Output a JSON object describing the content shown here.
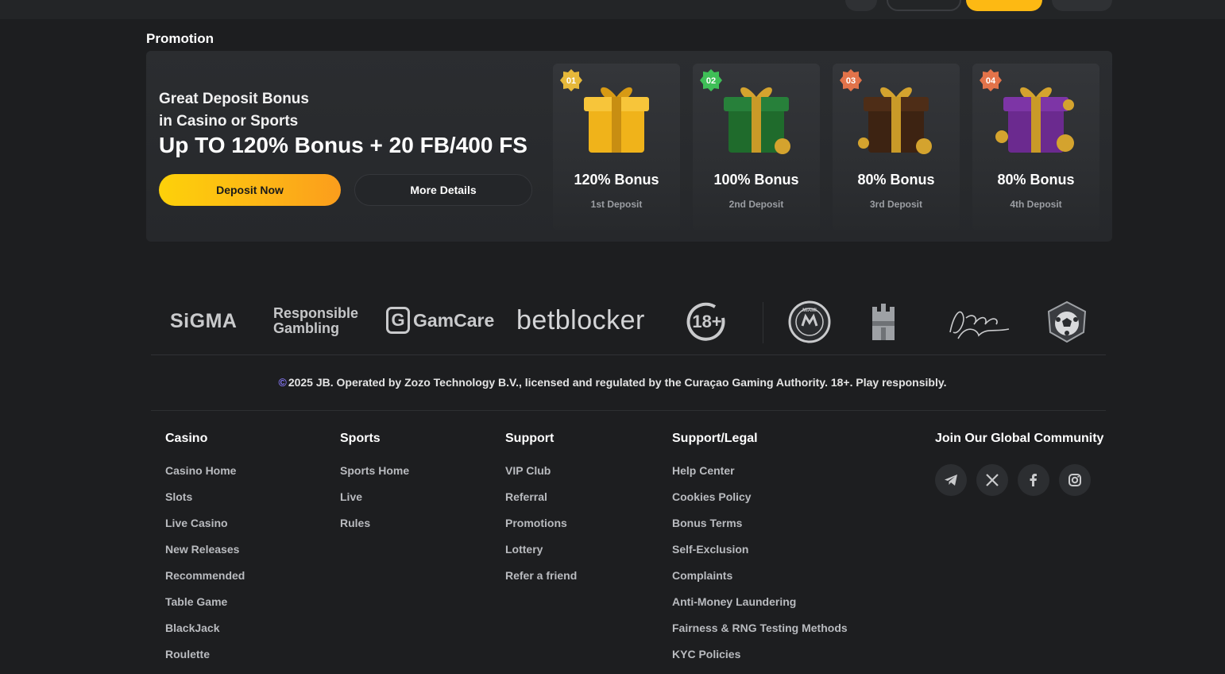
{
  "promotion": {
    "section_title": "Promotion",
    "line1": "Great Deposit Bonus",
    "line2": "in Casino or Sports",
    "headline": "Up TO 120% Bonus + 20 FB/400 FS",
    "deposit_button": "Deposit Now",
    "details_button": "More Details",
    "bonuses": [
      {
        "badge": "01",
        "value": "120% Bonus",
        "deposit": "1st Deposit",
        "gift_color": "#f0b31a",
        "badge_color": "#e6b83a"
      },
      {
        "badge": "02",
        "value": "100% Bonus",
        "deposit": "2nd Deposit",
        "gift_color": "#1f6b2c",
        "badge_color": "#3fbf57"
      },
      {
        "badge": "03",
        "value": "80% Bonus",
        "deposit": "3rd Deposit",
        "gift_color": "#3d2312",
        "badge_color": "#e2734a"
      },
      {
        "badge": "04",
        "value": "80% Bonus",
        "deposit": "4th Deposit",
        "gift_color": "#6b2a8f",
        "badge_color": "#e2734a"
      }
    ]
  },
  "partners": {
    "sigma": "SiGMA",
    "responsible_1": "Responsible",
    "responsible_2": "Gambling",
    "gamcare": "GamCare",
    "gamcare_letter": "G",
    "betblocker": "betblocker",
    "age": "18+",
    "miami_top": "MIAMI",
    "signature": "Jason Derulo"
  },
  "copyright": "2025 JB. Operated by Zozo Technology B.V., licensed and regulated by the Curaçao Gaming Authority. 18+. Play responsibly.",
  "footer": {
    "casino": {
      "title": "Casino",
      "links": [
        "Casino Home",
        "Slots",
        "Live Casino",
        "New Releases",
        "Recommended",
        "Table Game",
        "BlackJack",
        "Roulette"
      ]
    },
    "sports": {
      "title": "Sports",
      "links": [
        "Sports Home",
        "Live",
        "Rules"
      ]
    },
    "support": {
      "title": "Support",
      "links": [
        "VIP Club",
        "Referral",
        "Promotions",
        "Lottery",
        "Refer a friend"
      ]
    },
    "legal": {
      "title": "Support/Legal",
      "links": [
        "Help Center",
        "Cookies Policy",
        "Bonus Terms",
        "Self-Exclusion",
        "Complaints",
        "Anti-Money Laundering",
        "Fairness & RNG Testing Methods",
        "KYC Policies"
      ]
    },
    "community": {
      "title": "Join Our Global Community",
      "socials": [
        "telegram-icon",
        "x-icon",
        "facebook-icon",
        "instagram-icon"
      ]
    }
  },
  "colors": {
    "accent": "#fdb913",
    "background": "#1d1e20",
    "panel": "#2b2d30"
  }
}
